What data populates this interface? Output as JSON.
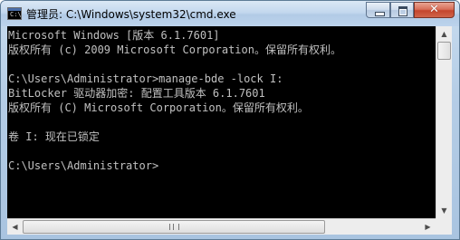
{
  "window": {
    "title": "管理员: C:\\Windows\\system32\\cmd.exe",
    "icon_label": "C:\\",
    "icon_name": "cmd-icon",
    "buttons": {
      "minimize_icon": "minimize-icon",
      "maximize_icon": "maximize-icon",
      "close_icon": "close-icon",
      "close_glyph": "✕"
    }
  },
  "console": {
    "background": "#000000",
    "text_color": "#c0c0c0",
    "lines": [
      "Microsoft Windows [版本 6.1.7601]",
      "版权所有 (c) 2009 Microsoft Corporation。保留所有权利。",
      "",
      "C:\\Users\\Administrator>manage-bde -lock I:",
      "BitLocker 驱动器加密: 配置工具版本 6.1.7601",
      "版权所有 (C) Microsoft Corporation。保留所有权利。",
      "",
      "卷 I: 现在已锁定",
      "",
      "C:\\Users\\Administrator>"
    ]
  },
  "scrollbars": {
    "up_arrow": "▲",
    "down_arrow": "▼",
    "left_arrow": "◀",
    "right_arrow": "▶"
  }
}
